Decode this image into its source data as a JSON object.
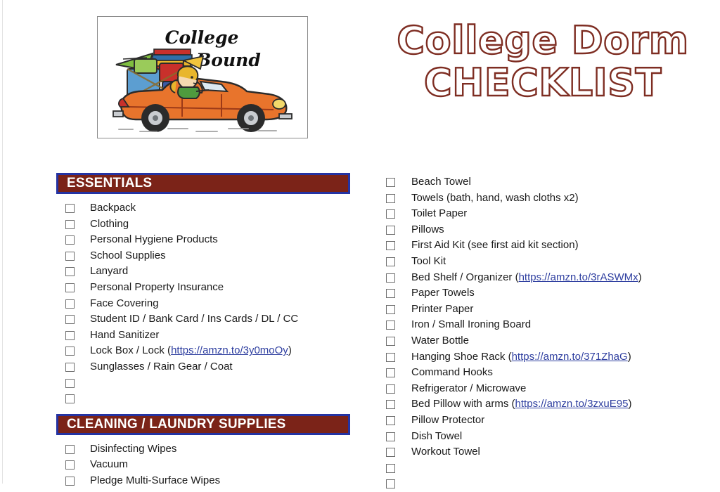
{
  "document": {
    "title_line_1": "College Dorm",
    "title_line_2": "CHECKLIST",
    "title_color": "#7E2D22",
    "clipart_caption_line_1": "College",
    "clipart_caption_line_2": "Bound",
    "clipart_alt": "Cartoon of a child driving an orange convertible car loaded with luggage, books and a pennant flag"
  },
  "theme": {
    "section_bar_fill": "#7B2318",
    "section_bar_border": "#2433A3",
    "section_bar_text": "#FFFFFF",
    "link_color": "#2F3FA0",
    "text_color": "#1A1A1A",
    "checkbox_border": "#6E6E6E",
    "page_background": "#FFFFFF"
  },
  "left_column": {
    "sections": [
      {
        "heading": "ESSENTIALS",
        "items": [
          {
            "text": "Backpack",
            "link": null,
            "link_prefix": null,
            "link_suffix": null
          },
          {
            "text": "Clothing",
            "link": null,
            "link_prefix": null,
            "link_suffix": null
          },
          {
            "text": "Personal Hygiene Products",
            "link": null,
            "link_prefix": null,
            "link_suffix": null
          },
          {
            "text": "School Supplies",
            "link": null,
            "link_prefix": null,
            "link_suffix": null
          },
          {
            "text": "Lanyard",
            "link": null,
            "link_prefix": null,
            "link_suffix": null
          },
          {
            "text": "Personal Property Insurance",
            "link": null,
            "link_prefix": null,
            "link_suffix": null
          },
          {
            "text": "Face Covering",
            "link": null,
            "link_prefix": null,
            "link_suffix": null
          },
          {
            "text": "Student ID / Bank Card / Ins Cards / DL / CC",
            "link": null,
            "link_prefix": null,
            "link_suffix": null
          },
          {
            "text": "Hand Sanitizer",
            "link": null,
            "link_prefix": null,
            "link_suffix": null
          },
          {
            "text": null,
            "link": "https://amzn.to/3y0moOy",
            "link_prefix": "Lock Box / Lock (",
            "link_suffix": ")"
          },
          {
            "text": "Sunglasses / Rain Gear / Coat",
            "link": null,
            "link_prefix": null,
            "link_suffix": null
          },
          {
            "text": "",
            "link": null,
            "link_prefix": null,
            "link_suffix": null
          },
          {
            "text": "",
            "link": null,
            "link_prefix": null,
            "link_suffix": null
          }
        ]
      },
      {
        "heading": "CLEANING / LAUNDRY SUPPLIES",
        "items": [
          {
            "text": "Disinfecting Wipes",
            "link": null,
            "link_prefix": null,
            "link_suffix": null
          },
          {
            "text": "Vacuum",
            "link": null,
            "link_prefix": null,
            "link_suffix": null
          },
          {
            "text": "Pledge Multi-Surface Wipes",
            "link": null,
            "link_prefix": null,
            "link_suffix": null
          }
        ]
      }
    ]
  },
  "right_column": {
    "items": [
      {
        "text": "Beach Towel",
        "link": null,
        "link_prefix": null,
        "link_suffix": null
      },
      {
        "text": "Towels (bath, hand, wash cloths x2)",
        "link": null,
        "link_prefix": null,
        "link_suffix": null
      },
      {
        "text": "Toilet Paper",
        "link": null,
        "link_prefix": null,
        "link_suffix": null
      },
      {
        "text": "Pillows",
        "link": null,
        "link_prefix": null,
        "link_suffix": null
      },
      {
        "text": "First Aid Kit (see first aid kit section)",
        "link": null,
        "link_prefix": null,
        "link_suffix": null
      },
      {
        "text": "Tool Kit",
        "link": null,
        "link_prefix": null,
        "link_suffix": null
      },
      {
        "text": null,
        "link": "https://amzn.to/3rASWMx",
        "link_prefix": "Bed Shelf / Organizer (",
        "link_suffix": ")"
      },
      {
        "text": "Paper Towels",
        "link": null,
        "link_prefix": null,
        "link_suffix": null
      },
      {
        "text": "Printer Paper",
        "link": null,
        "link_prefix": null,
        "link_suffix": null
      },
      {
        "text": "Iron / Small Ironing Board",
        "link": null,
        "link_prefix": null,
        "link_suffix": null
      },
      {
        "text": "Water Bottle",
        "link": null,
        "link_prefix": null,
        "link_suffix": null
      },
      {
        "text": null,
        "link": "https://amzn.to/371ZhaG",
        "link_prefix": "Hanging Shoe Rack (",
        "link_suffix": ")"
      },
      {
        "text": "Command Hooks",
        "link": null,
        "link_prefix": null,
        "link_suffix": null
      },
      {
        "text": "Refrigerator / Microwave",
        "link": null,
        "link_prefix": null,
        "link_suffix": null
      },
      {
        "text": null,
        "link": "https://amzn.to/3zxuE95",
        "link_prefix": "Bed Pillow with arms (",
        "link_suffix": ")"
      },
      {
        "text": "Pillow Protector",
        "link": null,
        "link_prefix": null,
        "link_suffix": null
      },
      {
        "text": "Dish Towel",
        "link": null,
        "link_prefix": null,
        "link_suffix": null
      },
      {
        "text": "Workout Towel",
        "link": null,
        "link_prefix": null,
        "link_suffix": null
      },
      {
        "text": "",
        "link": null,
        "link_prefix": null,
        "link_suffix": null
      },
      {
        "text": "",
        "link": null,
        "link_prefix": null,
        "link_suffix": null
      }
    ]
  }
}
